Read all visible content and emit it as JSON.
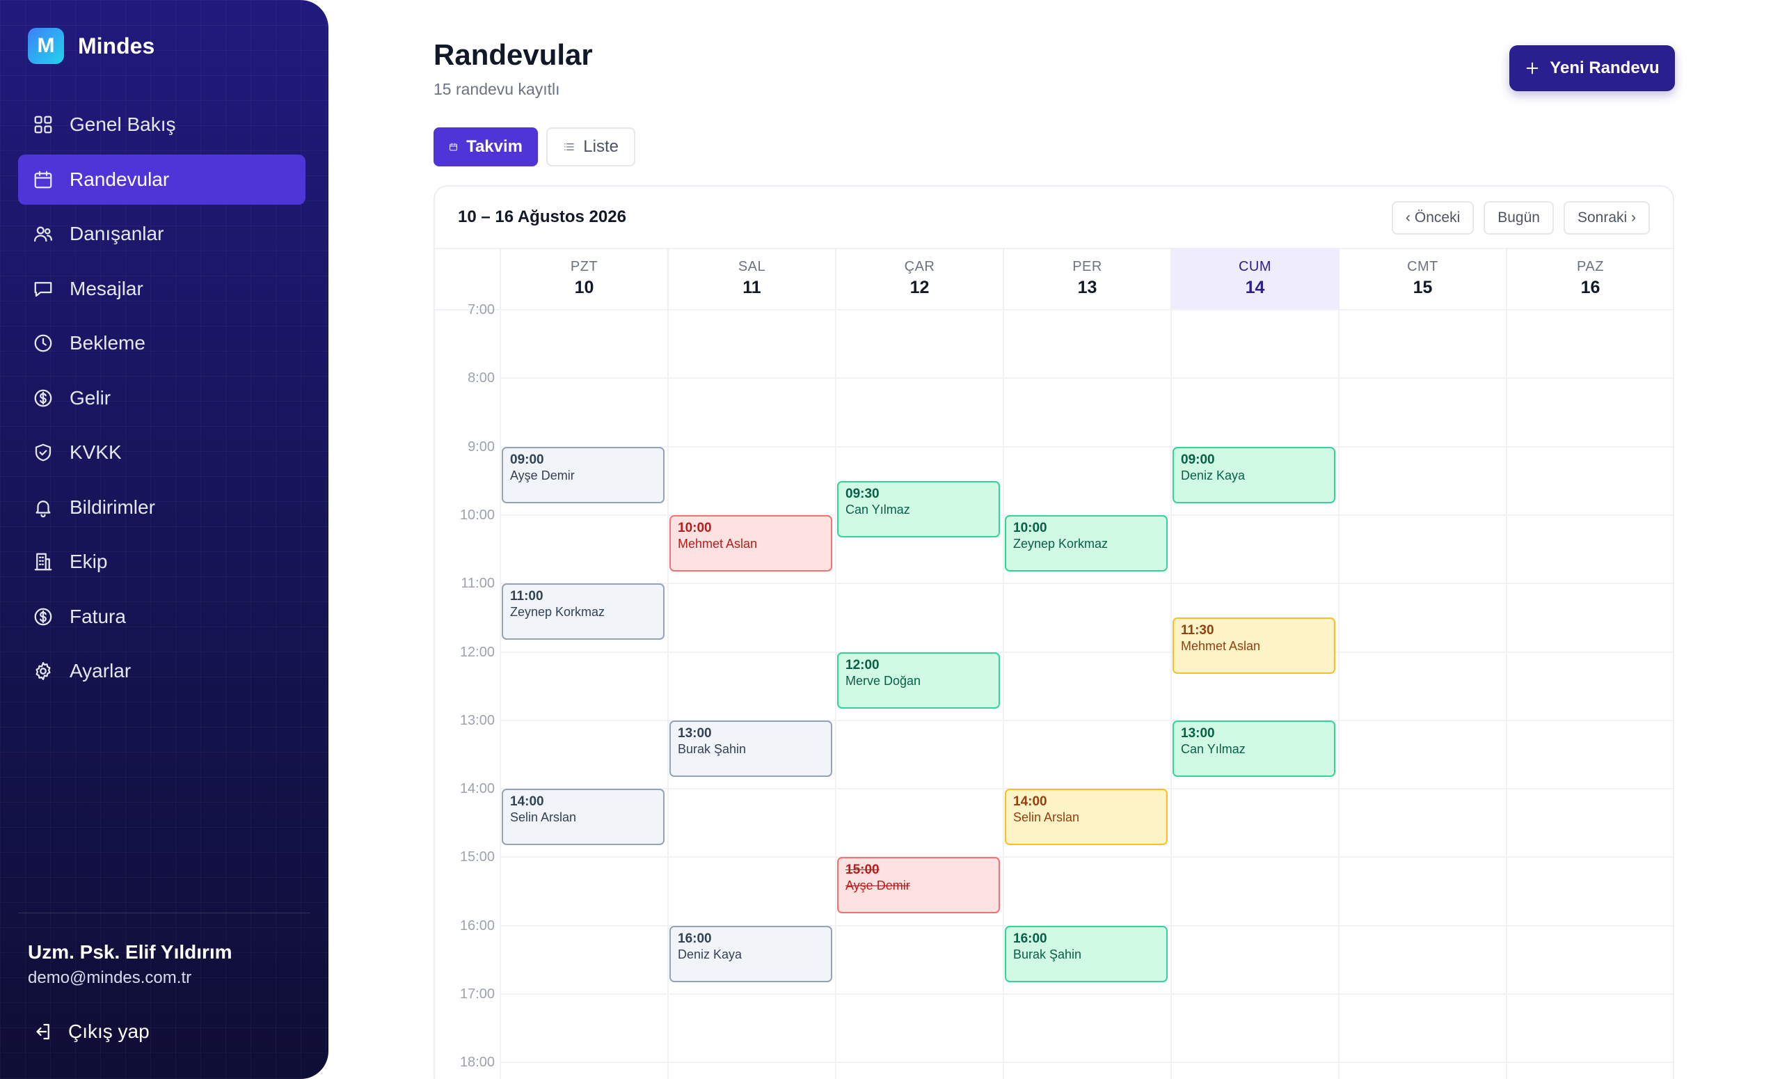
{
  "brand": {
    "logo_letter": "M",
    "name": "Mindes"
  },
  "sidebar": {
    "items": [
      {
        "label": "Genel Bakış",
        "icon": "grid-icon",
        "active": false
      },
      {
        "label": "Randevular",
        "icon": "calendar-icon",
        "active": true
      },
      {
        "label": "Danışanlar",
        "icon": "users-icon",
        "active": false
      },
      {
        "label": "Mesajlar",
        "icon": "message-icon",
        "active": false
      },
      {
        "label": "Bekleme",
        "icon": "clock-icon",
        "active": false
      },
      {
        "label": "Gelir",
        "icon": "dollar-icon",
        "active": false
      },
      {
        "label": "KVKK",
        "icon": "shield-icon",
        "active": false
      },
      {
        "label": "Bildirimler",
        "icon": "bell-icon",
        "active": false
      },
      {
        "label": "Ekip",
        "icon": "building-icon",
        "active": false
      },
      {
        "label": "Fatura",
        "icon": "dollar-icon",
        "active": false
      },
      {
        "label": "Ayarlar",
        "icon": "gear-icon",
        "active": false
      }
    ],
    "user": {
      "name": "Uzm. Psk. Elif Yıldırım",
      "email": "demo@mindes.com.tr"
    },
    "logout_label": "Çıkış yap"
  },
  "header": {
    "title": "Randevular",
    "subtitle": "15 randevu kayıtlı",
    "new_button": "Yeni Randevu"
  },
  "view_toggle": {
    "calendar": "Takvim",
    "list": "Liste",
    "selected": "calendar"
  },
  "calendar": {
    "range": "10 – 16 Ağustos 2026",
    "prev": "‹ Önceki",
    "today": "Bugün",
    "next": "Sonraki ›",
    "days": [
      {
        "name": "PZT",
        "num": "10",
        "today": false
      },
      {
        "name": "SAL",
        "num": "11",
        "today": false
      },
      {
        "name": "ÇAR",
        "num": "12",
        "today": false
      },
      {
        "name": "PER",
        "num": "13",
        "today": false
      },
      {
        "name": "CUM",
        "num": "14",
        "today": true
      },
      {
        "name": "CMT",
        "num": "15",
        "today": false
      },
      {
        "name": "PAZ",
        "num": "16",
        "today": false
      }
    ],
    "hours": [
      "7:00",
      "8:00",
      "9:00",
      "10:00",
      "11:00",
      "12:00",
      "13:00",
      "14:00",
      "15:00",
      "16:00",
      "17:00",
      "18:00"
    ],
    "colors": {
      "gray": "#94a3b8",
      "green": "#34d399",
      "red": "#f87171",
      "amber": "#fbbf24"
    },
    "appointments": [
      {
        "day": 0,
        "start": 9.0,
        "time": "09:00",
        "client": "Ayşe Demir",
        "status": "gray"
      },
      {
        "day": 0,
        "start": 11.0,
        "time": "11:00",
        "client": "Zeynep Korkmaz",
        "status": "gray"
      },
      {
        "day": 0,
        "start": 14.0,
        "time": "14:00",
        "client": "Selin Arslan",
        "status": "gray"
      },
      {
        "day": 1,
        "start": 10.0,
        "time": "10:00",
        "client": "Mehmet Aslan",
        "status": "red"
      },
      {
        "day": 1,
        "start": 13.0,
        "time": "13:00",
        "client": "Burak Şahin",
        "status": "gray"
      },
      {
        "day": 1,
        "start": 16.0,
        "time": "16:00",
        "client": "Deniz Kaya",
        "status": "gray"
      },
      {
        "day": 2,
        "start": 9.5,
        "time": "09:30",
        "client": "Can Yılmaz",
        "status": "green"
      },
      {
        "day": 2,
        "start": 12.0,
        "time": "12:00",
        "client": "Merve Doğan",
        "status": "green"
      },
      {
        "day": 2,
        "start": 15.0,
        "time": "15:00",
        "client": "Ayşe Demir",
        "status": "red",
        "cancelled": true
      },
      {
        "day": 3,
        "start": 10.0,
        "time": "10:00",
        "client": "Zeynep Korkmaz",
        "status": "green"
      },
      {
        "day": 3,
        "start": 14.0,
        "time": "14:00",
        "client": "Selin Arslan",
        "status": "amber"
      },
      {
        "day": 3,
        "start": 16.0,
        "time": "16:00",
        "client": "Burak Şahin",
        "status": "green"
      },
      {
        "day": 4,
        "start": 9.0,
        "time": "09:00",
        "client": "Deniz Kaya",
        "status": "green"
      },
      {
        "day": 4,
        "start": 11.5,
        "time": "11:30",
        "client": "Mehmet Aslan",
        "status": "amber"
      },
      {
        "day": 4,
        "start": 13.0,
        "time": "13:00",
        "client": "Can Yılmaz",
        "status": "green"
      }
    ]
  }
}
